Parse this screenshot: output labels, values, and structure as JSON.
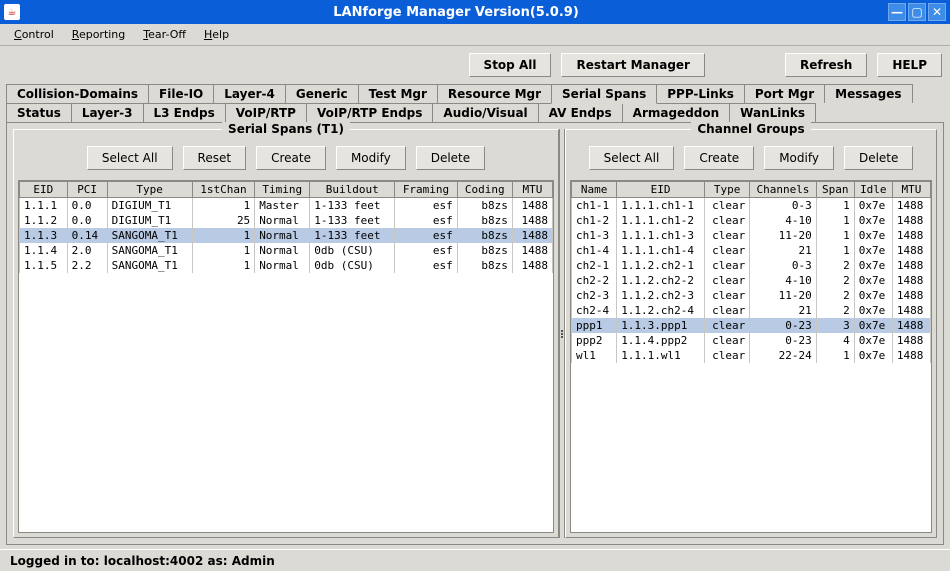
{
  "title": "LANforge Manager    Version(5.0.9)",
  "menu": {
    "control": "Control",
    "reporting": "Reporting",
    "tearoff": "Tear-Off",
    "help": "Help"
  },
  "topbtn": {
    "stopall": "Stop All",
    "restart": "Restart Manager",
    "refresh": "Refresh",
    "help": "HELP"
  },
  "tabs_row1": [
    "Collision-Domains",
    "File-IO",
    "Layer-4",
    "Generic",
    "Test Mgr",
    "Resource Mgr",
    "Serial Spans",
    "PPP-Links",
    "Port Mgr",
    "Messages"
  ],
  "tabs_row2": [
    "Status",
    "Layer-3",
    "L3 Endps",
    "VoIP/RTP",
    "VoIP/RTP Endps",
    "Audio/Visual",
    "AV Endps",
    "Armageddon",
    "WanLinks"
  ],
  "selected_tab": "Serial Spans",
  "left": {
    "title": "Serial Spans (T1)",
    "btns": {
      "selectall": "Select All",
      "reset": "Reset",
      "create": "Create",
      "modify": "Modify",
      "delete": "Delete"
    },
    "cols": [
      "EID",
      "PCI",
      "Type",
      "1stChan",
      "Timing",
      "Buildout",
      "Framing",
      "Coding",
      "MTU"
    ],
    "rows": [
      {
        "eid": "1.1.1",
        "pci": "0.0",
        "type": "DIGIUM_T1",
        "fc": "1",
        "timing": "Master",
        "build": "1-133 feet",
        "fram": "esf",
        "cod": "b8zs",
        "mtu": "1488",
        "sel": false
      },
      {
        "eid": "1.1.2",
        "pci": "0.0",
        "type": "DIGIUM_T1",
        "fc": "25",
        "timing": "Normal",
        "build": "1-133 feet",
        "fram": "esf",
        "cod": "b8zs",
        "mtu": "1488",
        "sel": false
      },
      {
        "eid": "1.1.3",
        "pci": "0.14",
        "type": "SANGOMA_T1",
        "fc": "1",
        "timing": "Normal",
        "build": "1-133 feet",
        "fram": "esf",
        "cod": "b8zs",
        "mtu": "1488",
        "sel": true
      },
      {
        "eid": "1.1.4",
        "pci": "2.0",
        "type": "SANGOMA_T1",
        "fc": "1",
        "timing": "Normal",
        "build": "0db (CSU)",
        "fram": "esf",
        "cod": "b8zs",
        "mtu": "1488",
        "sel": false
      },
      {
        "eid": "1.1.5",
        "pci": "2.2",
        "type": "SANGOMA_T1",
        "fc": "1",
        "timing": "Normal",
        "build": "0db (CSU)",
        "fram": "esf",
        "cod": "b8zs",
        "mtu": "1488",
        "sel": false
      }
    ]
  },
  "right": {
    "title": "Channel Groups",
    "btns": {
      "selectall": "Select All",
      "create": "Create",
      "modify": "Modify",
      "delete": "Delete"
    },
    "cols": [
      "Name",
      "EID",
      "Type",
      "Channels",
      "Span",
      "Idle",
      "MTU"
    ],
    "rows": [
      {
        "name": "ch1-1",
        "eid": "1.1.1.ch1-1",
        "type": "clear",
        "ch": "0-3",
        "span": "1",
        "idle": "0x7e",
        "mtu": "1488",
        "sel": false
      },
      {
        "name": "ch1-2",
        "eid": "1.1.1.ch1-2",
        "type": "clear",
        "ch": "4-10",
        "span": "1",
        "idle": "0x7e",
        "mtu": "1488",
        "sel": false
      },
      {
        "name": "ch1-3",
        "eid": "1.1.1.ch1-3",
        "type": "clear",
        "ch": "11-20",
        "span": "1",
        "idle": "0x7e",
        "mtu": "1488",
        "sel": false
      },
      {
        "name": "ch1-4",
        "eid": "1.1.1.ch1-4",
        "type": "clear",
        "ch": "21",
        "span": "1",
        "idle": "0x7e",
        "mtu": "1488",
        "sel": false
      },
      {
        "name": "ch2-1",
        "eid": "1.1.2.ch2-1",
        "type": "clear",
        "ch": "0-3",
        "span": "2",
        "idle": "0x7e",
        "mtu": "1488",
        "sel": false
      },
      {
        "name": "ch2-2",
        "eid": "1.1.2.ch2-2",
        "type": "clear",
        "ch": "4-10",
        "span": "2",
        "idle": "0x7e",
        "mtu": "1488",
        "sel": false
      },
      {
        "name": "ch2-3",
        "eid": "1.1.2.ch2-3",
        "type": "clear",
        "ch": "11-20",
        "span": "2",
        "idle": "0x7e",
        "mtu": "1488",
        "sel": false
      },
      {
        "name": "ch2-4",
        "eid": "1.1.2.ch2-4",
        "type": "clear",
        "ch": "21",
        "span": "2",
        "idle": "0x7e",
        "mtu": "1488",
        "sel": false
      },
      {
        "name": "ppp1",
        "eid": "1.1.3.ppp1",
        "type": "clear",
        "ch": "0-23",
        "span": "3",
        "idle": "0x7e",
        "mtu": "1488",
        "sel": true
      },
      {
        "name": "ppp2",
        "eid": "1.1.4.ppp2",
        "type": "clear",
        "ch": "0-23",
        "span": "4",
        "idle": "0x7e",
        "mtu": "1488",
        "sel": false
      },
      {
        "name": "wl1",
        "eid": "1.1.1.wl1",
        "type": "clear",
        "ch": "22-24",
        "span": "1",
        "idle": "0x7e",
        "mtu": "1488",
        "sel": false
      }
    ]
  },
  "status": "Logged in to:  localhost:4002  as:  Admin"
}
